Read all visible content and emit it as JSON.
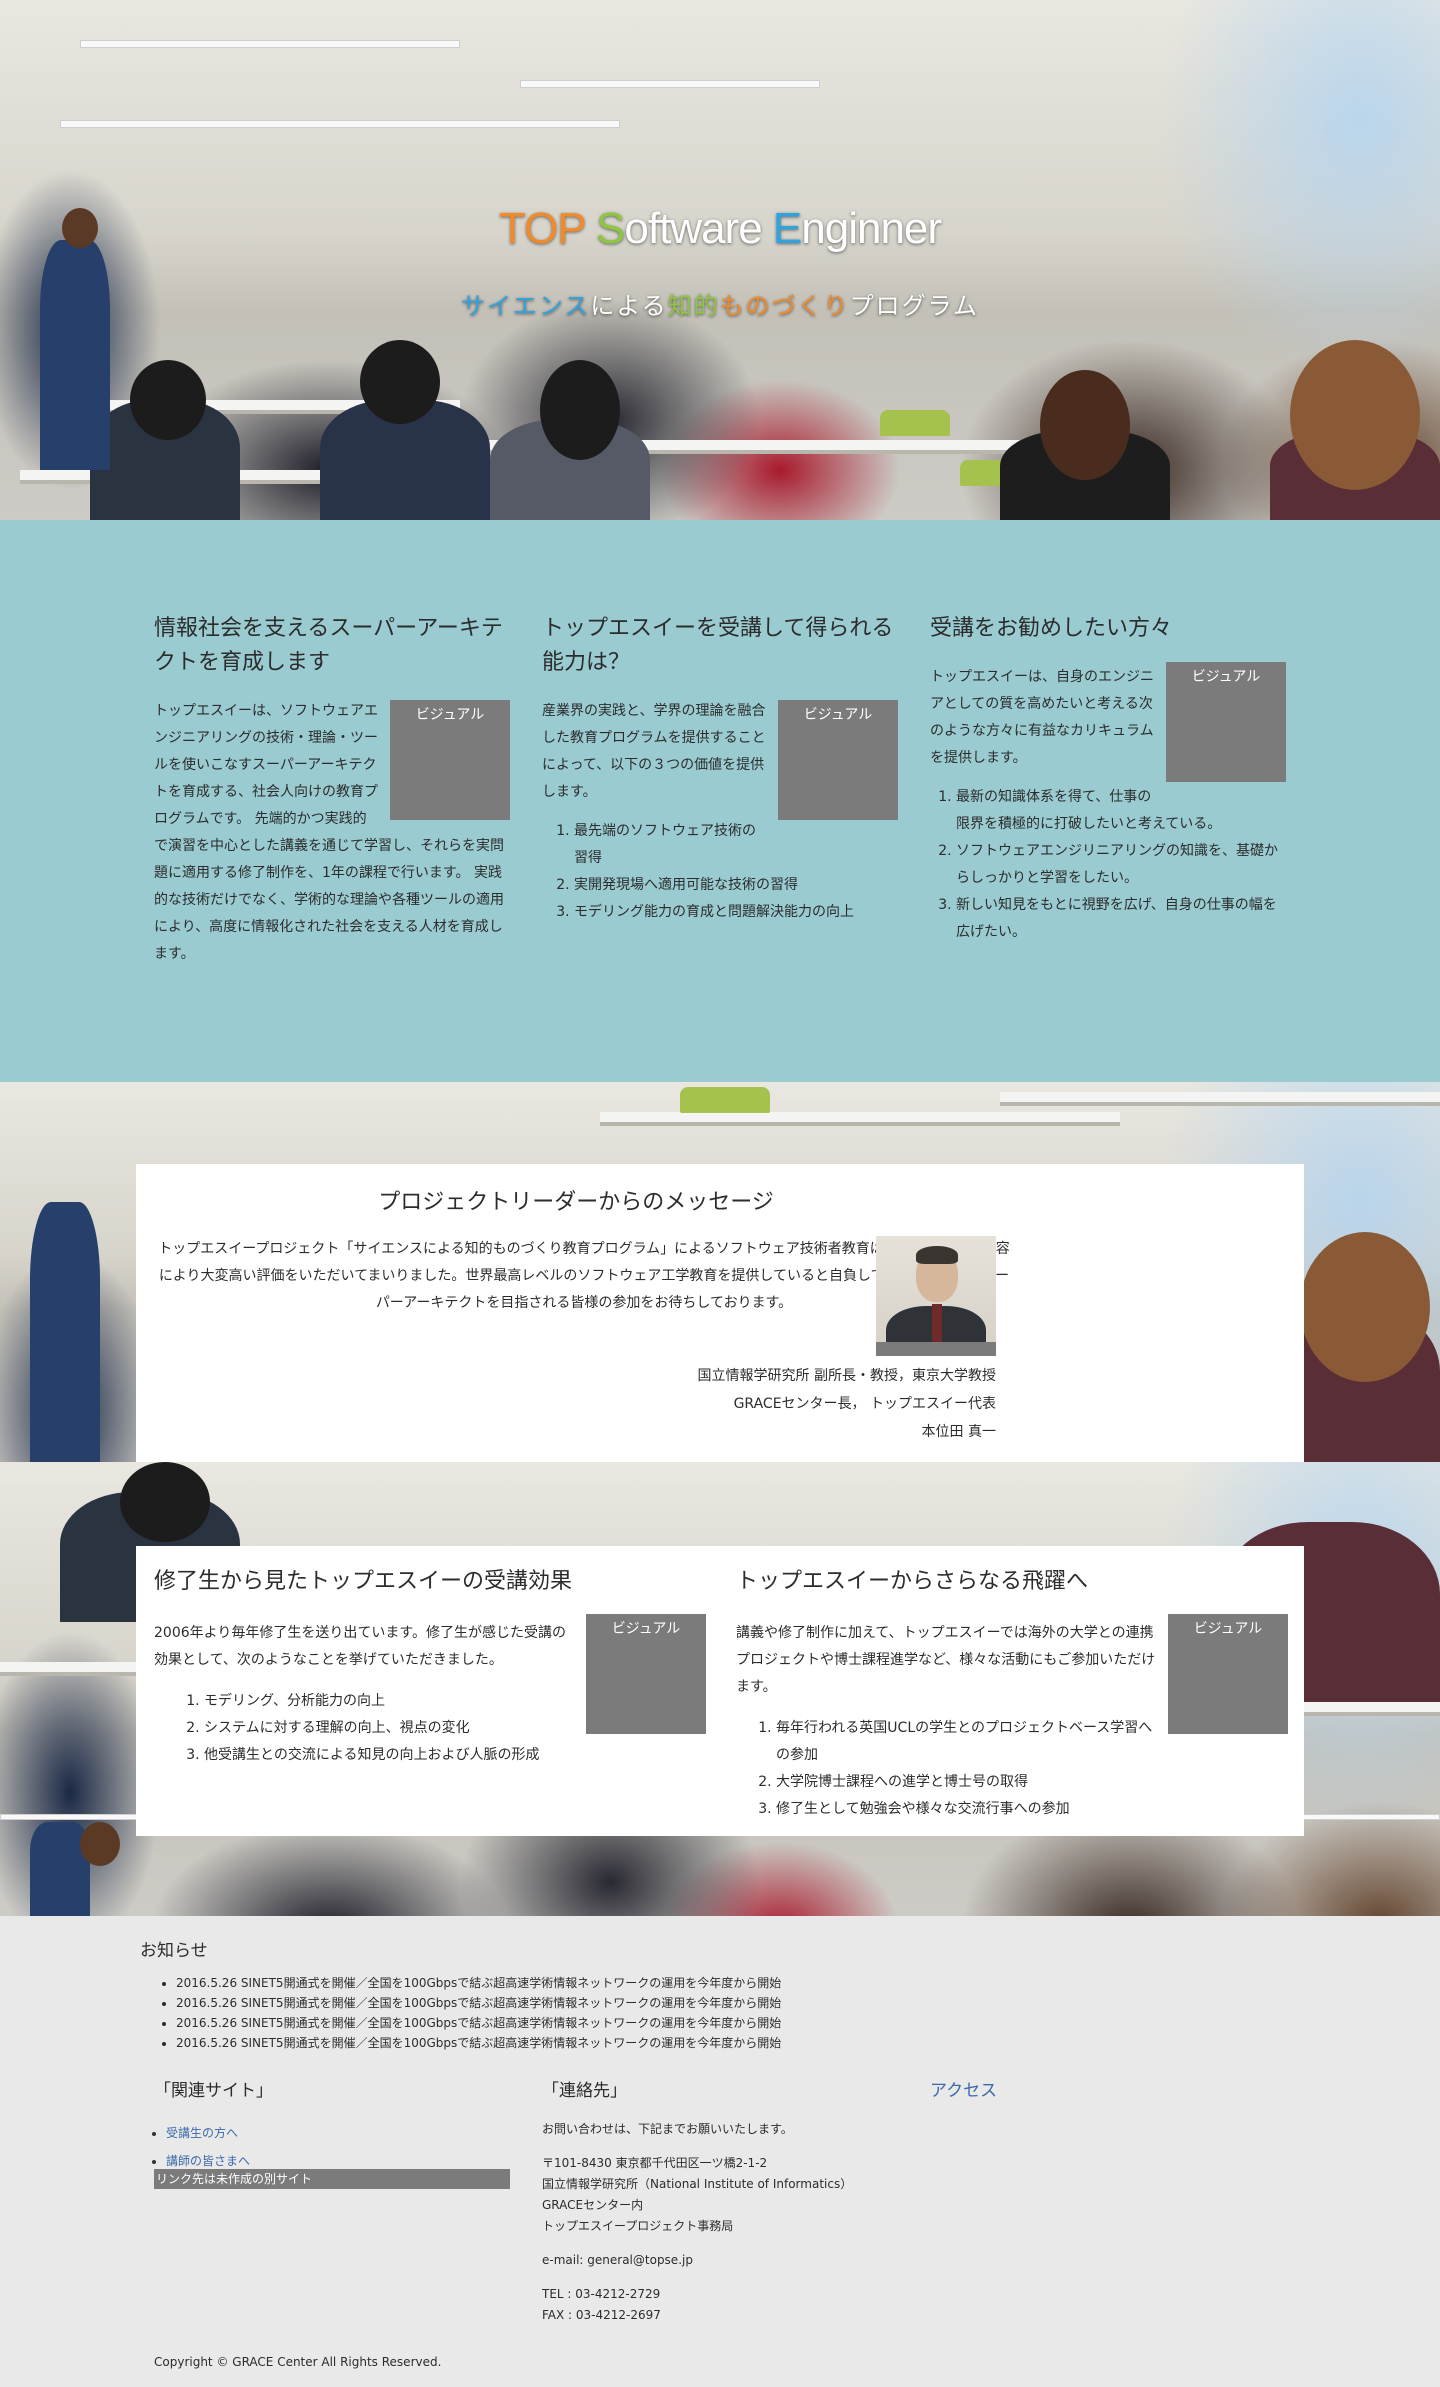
{
  "hero": {
    "title_parts": [
      "TOP",
      " ",
      "S",
      "oftware ",
      "E",
      "nginner"
    ],
    "subtitle_parts": [
      "サイエンス",
      "による",
      "知的",
      "ものづくり",
      "プログラム"
    ]
  },
  "intro": {
    "columns": [
      {
        "heading": "情報社会を支えるスーパーアーキテクトを育成します",
        "visual_label": "ビジュアル",
        "body": "トップエスイーは、ソフトウェアエンジニアリングの技術・理論・ツールを使いこなすスーパーアーキテクトを育成する、社会人向けの教育プログラムです。 先端的かつ実践的で演習を中心とした講義を通じて学習し、それらを実問題に適用する修了制作を、1年の課程で行います。 実践的な技術だけでなく、学術的な理論や各種ツールの適用により、高度に情報化された社会を支える人材を育成します。",
        "items": []
      },
      {
        "heading": "トップエスイーを受講して得られる能力は？",
        "visual_label": "ビジュアル",
        "body": "産業界の実践と、学界の理論を融合した教育プログラムを提供することによって、以下の３つの価値を提供します。",
        "items": [
          "最先端のソフトウェア技術の習得",
          "実開発現場へ適用可能な技術の習得",
          "モデリング能力の育成と問題解決能力の向上"
        ]
      },
      {
        "heading": "受講をお勧めしたい方々",
        "visual_label": "ビジュアル",
        "body": "トップエスイーは、自身のエンジニアとしての質を高めたいと考える次のような方々に有益なカリキュラムを提供します。",
        "items": [
          "最新の知識体系を得て、仕事の限界を積極的に打破したいと考えている。",
          "ソフトウェアエンジリニアリングの知識を、基礎からしっかりと学習をしたい。",
          "新しい知見をもとに視野を広げ、自身の仕事の幅を広げたい。"
        ]
      }
    ]
  },
  "message": {
    "heading": "プロジェクトリーダーからのメッセージ",
    "body": "トップエスイープロジェクト「サイエンスによる知的ものづくり教育プログラム」によるソフトウェア技術者教育は、その実践的な内容により大変高い評価をいただいてまいりました。世界最高レベルのソフトウェア工学教育を提供していると自負しています。未来のスーパーアーキテクトを目指される皆様の参加をお待ちしております。",
    "signature": [
      "国立情報学研究所 副所長・教授，東京大学教授",
      "GRACEセンター長， トップエスイー代表",
      "本位田 真一"
    ]
  },
  "effects": {
    "columns": [
      {
        "heading": "修了生から見たトップエスイーの受講効果",
        "visual_label": "ビジュアル",
        "body": "2006年より毎年修了生を送り出ています。修了生が感じた受講の効果として、次のようなことを挙げていただきました。",
        "items": [
          "モデリング、分析能力の向上",
          "システムに対する理解の向上、視点の変化",
          "他受講生との交流による知見の向上および人脈の形成"
        ]
      },
      {
        "heading": "トップエスイーからさらなる飛躍へ",
        "visual_label": "ビジュアル",
        "body": "講義や修了制作に加えて、トップエスイーでは海外の大学との連携プロジェクトや博士課程進学など、様々な活動にもご参加いただけます。",
        "items": [
          "毎年行われる英国UCLの学生とのプロジェクトベース学習への参加",
          "大学院博士課程への進学と博士号の取得",
          "修了生として勉強会や様々な交流行事への参加"
        ]
      }
    ]
  },
  "news": {
    "title": "お知らせ",
    "items": [
      "2016.5.26 SINET5開通式を開催／全国を100Gbpsで結ぶ超高速学術情報ネットワークの運用を今年度から開始",
      "2016.5.26 SINET5開通式を開催／全国を100Gbpsで結ぶ超高速学術情報ネットワークの運用を今年度から開始",
      "2016.5.26 SINET5開通式を開催／全国を100Gbpsで結ぶ超高速学術情報ネットワークの運用を今年度から開始",
      "2016.5.26 SINET5開通式を開催／全国を100Gbpsで結ぶ超高速学術情報ネットワークの運用を今年度から開始"
    ]
  },
  "footer": {
    "related_title": "「関連サイト」",
    "related_links": [
      "受講生の方へ",
      "講師の皆さまへ"
    ],
    "related_note": "リンク先は未作成の別サイト",
    "contact_title": "「連絡先」",
    "contact_intro": "お問い合わせは、下記までお願いいたします。",
    "address_lines": [
      "〒101-8430 東京都千代田区一ツ橋2-1-2",
      "国立情報学研究所（National Institute of Informatics）",
      "GRACEセンター内",
      "トップエスイープロジェクト事務局"
    ],
    "email": "e-mail: general@topse.jp",
    "tel": "TEL : 03-4212-2729",
    "fax": "FAX : 03-4212-2697",
    "access_label": "アクセス",
    "copyright": "Copyright © GRACE Center All Rights Reserved."
  }
}
